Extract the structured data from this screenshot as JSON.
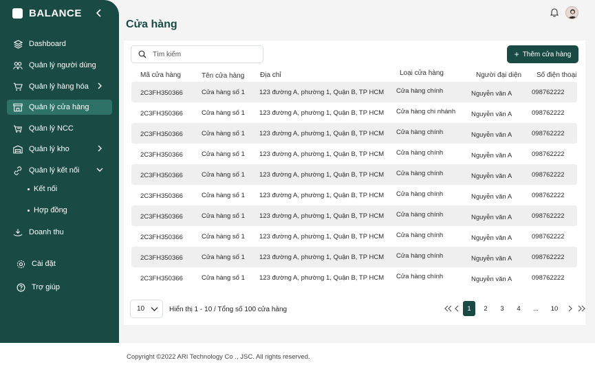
{
  "brand": {
    "name": "BALANCE"
  },
  "sidebar": {
    "items": [
      {
        "label": "Dashboard",
        "icon": "layers-icon"
      },
      {
        "label": "Quản lý người dùng",
        "icon": "users-icon"
      },
      {
        "label": "Quản lý hàng hóa",
        "icon": "cart-icon"
      },
      {
        "label": "Quản lý cửa hàng",
        "icon": "store-icon"
      },
      {
        "label": "Quản lý NCC",
        "icon": "truck-icon"
      },
      {
        "label": "Quản lý kho",
        "icon": "warehouse-icon"
      },
      {
        "label": "Quản lý kết nối",
        "icon": "link-icon"
      },
      {
        "label": "Doanh thu",
        "icon": "revenue-icon"
      },
      {
        "label": "Cài đặt",
        "icon": "gear-icon"
      },
      {
        "label": "Trợ giúp",
        "icon": "help-icon"
      }
    ],
    "subitems": [
      {
        "label": "Kết nối"
      },
      {
        "label": "Hợp đồng"
      }
    ],
    "active_color": "#2e7267",
    "bg_color": "#1a4a44"
  },
  "header": {
    "title": "Cửa hàng"
  },
  "search": {
    "placeholder": "Tìm kiếm"
  },
  "actions": {
    "add_label": "Thêm cửa hàng"
  },
  "table": {
    "columns": [
      "Mã cửa hàng",
      "Tên cửa hàng",
      "Địa chỉ",
      "Loại cửa hàng",
      "Người đại diện",
      "Số điện thoại"
    ],
    "rows": [
      [
        "2C3FH350366",
        "Cửa hàng số 1",
        "123 đường A, phường 1, Quận B, TP HCM",
        "Cửa hàng chính",
        "Nguyễn văn A",
        "098762222"
      ],
      [
        "2C3FH350366",
        "Cửa hàng số 1",
        "123 đường A, phường 1, Quận B, TP HCM",
        "Cửa hàng chi nhánh",
        "Nguyễn văn A",
        "098762222"
      ],
      [
        "2C3FH350366",
        "Cửa hàng số 1",
        "123 đường A, phường 1, Quận B, TP HCM",
        "Cửa hàng chính",
        "Nguyễn văn A",
        "098762222"
      ],
      [
        "2C3FH350366",
        "Cửa hàng số 1",
        "123 đường A, phường 1, Quận B, TP HCM",
        "Cửa hàng chính",
        "Nguyễn văn A",
        "098762222"
      ],
      [
        "2C3FH350366",
        "Cửa hàng số 1",
        "123 đường A, phường 1, Quận B, TP HCM",
        "Cửa hàng chính",
        "Nguyễn văn A",
        "098762222"
      ],
      [
        "2C3FH350366",
        "Cửa hàng số 1",
        "123 đường A, phường 1, Quận B, TP HCM",
        "Cửa hàng chính",
        "Nguyễn văn A",
        "098762222"
      ],
      [
        "2C3FH350366",
        "Cửa hàng số 1",
        "123 đường A, phường 1, Quận B, TP HCM",
        "Cửa hàng chính",
        "Nguyễn văn A",
        "098762222"
      ],
      [
        "2C3FH350366",
        "Cửa hàng số 1",
        "123 đường A, phường 1, Quận B, TP HCM",
        "Cửa hàng chính",
        "Nguyễn văn A",
        "098762222"
      ],
      [
        "2C3FH350366",
        "Cửa hàng số 1",
        "123 đường A, phường 1, Quận B, TP HCM",
        "Cửa hàng chính",
        "Nguyễn văn A",
        "098762222"
      ],
      [
        "2C3FH350366",
        "Cửa hàng số 1",
        "123 đường A, phường 1, Quận B, TP HCM",
        "Cửa hàng chính",
        "Nguyễn văn A",
        "098762222"
      ]
    ]
  },
  "pagination": {
    "page_size": "10",
    "info": "Hiển thị 1 - 10 / Tổng số 100 cửa hàng",
    "pages": [
      "1",
      "2",
      "3",
      "4",
      "...",
      "10"
    ],
    "current": "1"
  },
  "footer": {
    "copyright": "Copyright ©2022 ARI Technology Co ., JSC. All rights reserved."
  }
}
